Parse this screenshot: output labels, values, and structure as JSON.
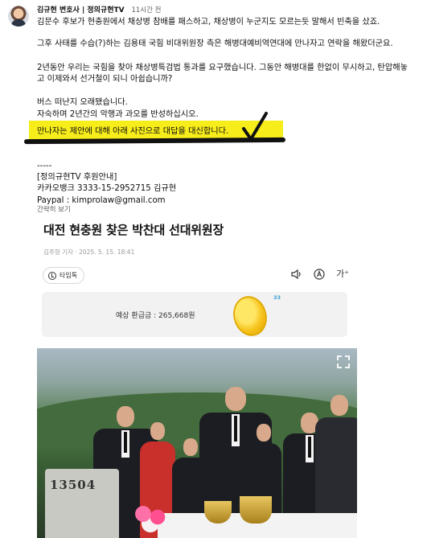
{
  "post": {
    "author": "김규현 변호사 | 정의규현TV",
    "time": "11시간 전",
    "lines": [
      "김문수 후보가 현충원에서 채상병 참배를 패스하고, 채상병이 누군지도 모르는듯 말해서 빈축을 샀죠.",
      "그후 사태를 수습(?)하는 김용태 국힘 비대위원장 측은 해병대예비역연대에 만나자고 연락을 해왔더군요.",
      "2년동안 우리는 국힘을 찾아 채상병특검법 통과를 요구했습니다. 그동안 해병대를 한없이 무시하고, 탄압해놓",
      "고 이제와서 선거철이 되니 아쉽습니까?",
      "버스 떠난지 오래됐습니다.",
      "자숙하며 2년간의 악행과 과오를 반성하십시오.",
      "만나자는 제안에 대해 아래 사진으로 대답을 대신합니다."
    ],
    "separator": "-----",
    "support_title": "[정의규현TV 후원안내]",
    "bank": "카카오뱅크 3333-15-2952715 김규현",
    "paypal": "Paypal : kimprolaw@gmail.com",
    "more_label": "간략히 보기"
  },
  "article": {
    "title": "대전 현충원 찾은 박찬대 선대위원장",
    "byline": "김주형 기자 · 2025. 5. 15. 18:41",
    "timeline_label": "타임톡",
    "tools": {
      "font_size_label": "가⁺"
    },
    "refund_label": "예상 환급금 : 265,668원",
    "coin_badge": "33",
    "photo": {
      "gravestone_number": "13504"
    }
  }
}
